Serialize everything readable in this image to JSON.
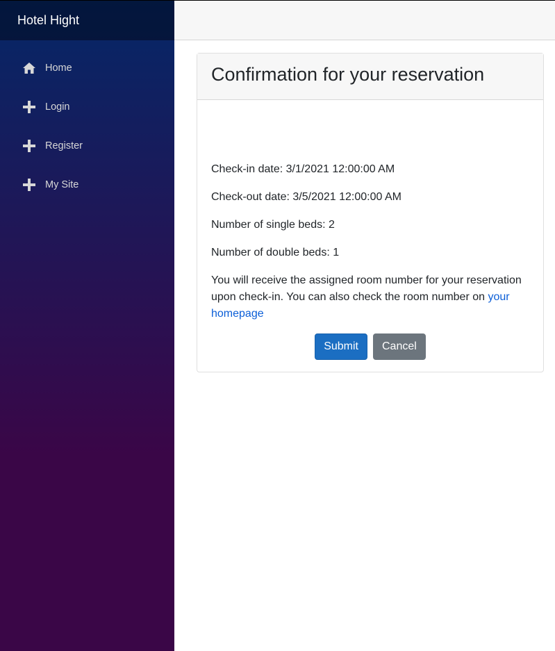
{
  "brand": "Hotel Hight",
  "nav": [
    {
      "label": "Home",
      "icon": "home-icon"
    },
    {
      "label": "Login",
      "icon": "plus-icon"
    },
    {
      "label": "Register",
      "icon": "plus-icon"
    },
    {
      "label": "My Site",
      "icon": "plus-icon"
    }
  ],
  "card": {
    "title": "Confirmation for your reservation",
    "checkin": "Check-in date: 3/1/2021 12:00:00 AM",
    "checkout": "Check-out date: 3/5/2021 12:00:00 AM",
    "single_beds": "Number of single beds: 2",
    "double_beds": "Number of double beds: 1",
    "note_text": "You will receive the assigned room number for your reservation upon check-in. You can also check the room number on ",
    "note_link": "your homepage"
  },
  "buttons": {
    "submit": "Submit",
    "cancel": "Cancel"
  },
  "colors": {
    "primary": "#1b6ec2",
    "secondary": "#6c757d",
    "link": "#0b5ed7",
    "sidebar_top": "#052767",
    "sidebar_bottom": "#3a0647"
  }
}
